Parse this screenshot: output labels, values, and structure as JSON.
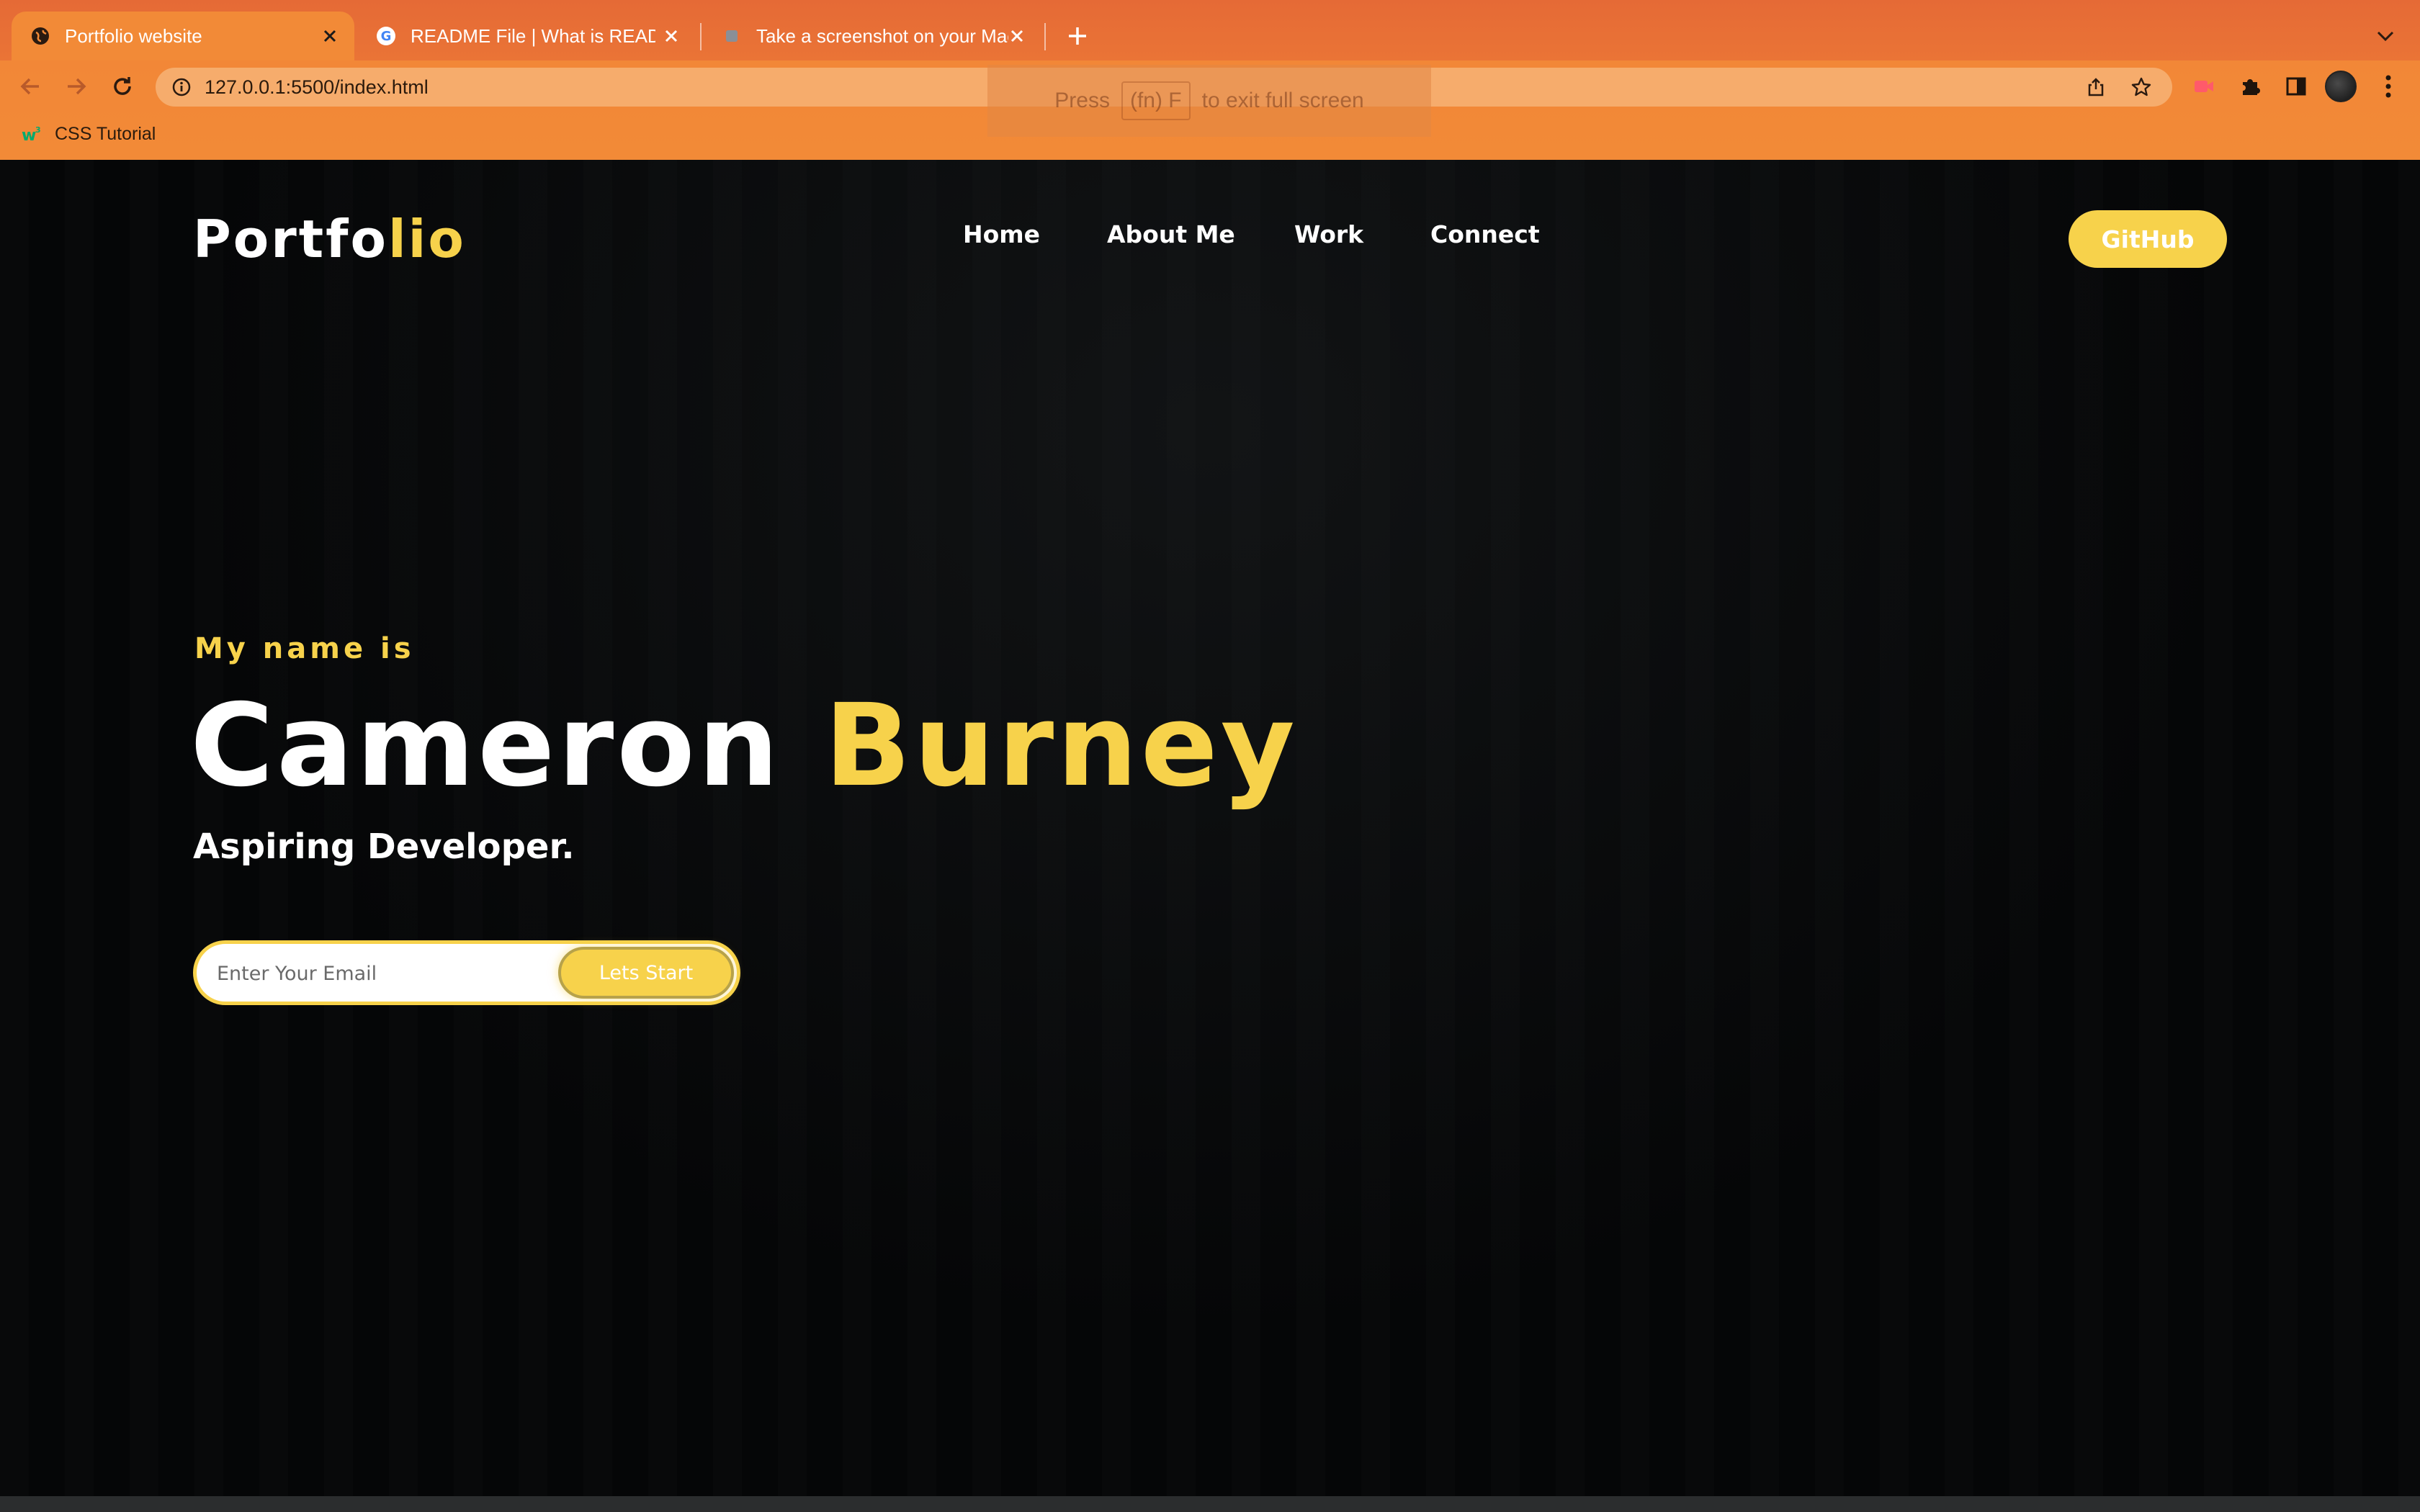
{
  "browser": {
    "tabs": [
      {
        "title": "Portfolio website",
        "active": true,
        "favicon": "globe-icon"
      },
      {
        "title": "README File | What is READM",
        "active": false,
        "favicon": "google-g-icon"
      },
      {
        "title": "Take a screenshot on your Mac",
        "active": false,
        "favicon": "apple-icon"
      }
    ],
    "url": "127.0.0.1:5500/index.html",
    "fullscreen_toast": {
      "press": "Press",
      "key": "(fn) F",
      "suffix": "to exit full screen"
    },
    "bookmarks": [
      {
        "label": "CSS Tutorial",
        "icon": "w3schools-icon"
      }
    ]
  },
  "page": {
    "logo": {
      "main": "Portfo",
      "accent": "lio"
    },
    "nav": [
      "Home",
      "About Me",
      "Work",
      "Connect"
    ],
    "github_label": "GitHub",
    "hero": {
      "intro": "My name is",
      "first_name": "Cameron",
      "last_name": "Burney",
      "role": "Aspiring Developer."
    },
    "signup": {
      "placeholder": "Enter Your Email",
      "button": "Lets Start"
    }
  },
  "colors": {
    "accent_yellow": "#f7d24b",
    "chrome_orange": "#f28a37",
    "page_background": "#050607"
  }
}
